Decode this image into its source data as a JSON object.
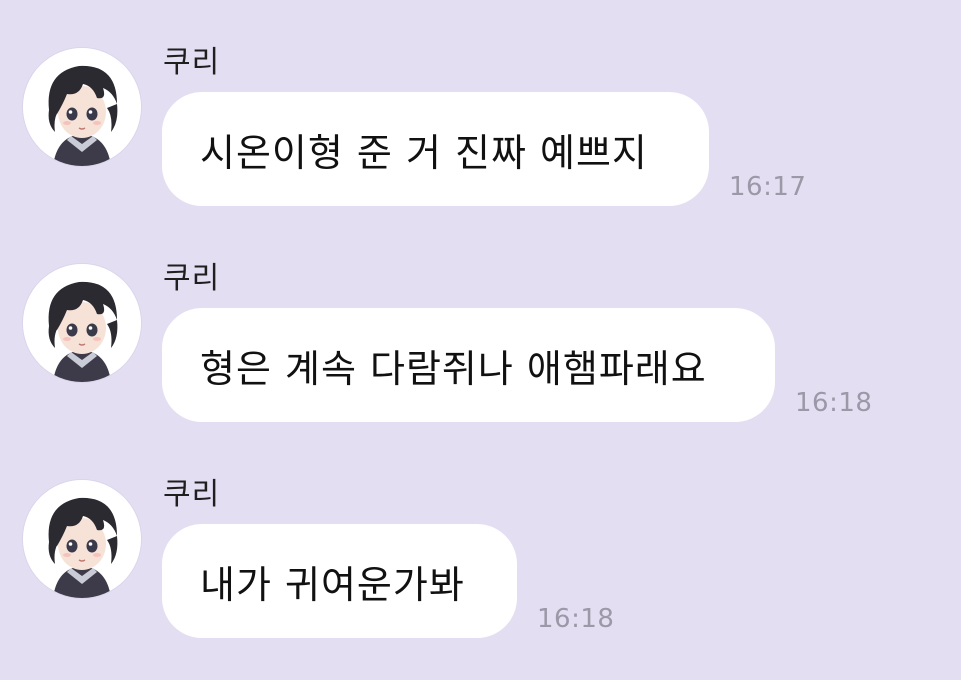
{
  "messages": [
    {
      "sender": "쿠리",
      "text": "시온이형 준 거 진짜 예쁘지",
      "time": "16:17"
    },
    {
      "sender": "쿠리",
      "text": "형은 계속 다람쥐나 애햄파래요",
      "time": "16:18"
    },
    {
      "sender": "쿠리",
      "text": "내가 귀여운가봐",
      "time": "16:18"
    }
  ],
  "colors": {
    "background": "#e4def3",
    "bubble": "#ffffff",
    "timestamp": "#9c98a8"
  },
  "icons": [
    "profile-avatar"
  ]
}
